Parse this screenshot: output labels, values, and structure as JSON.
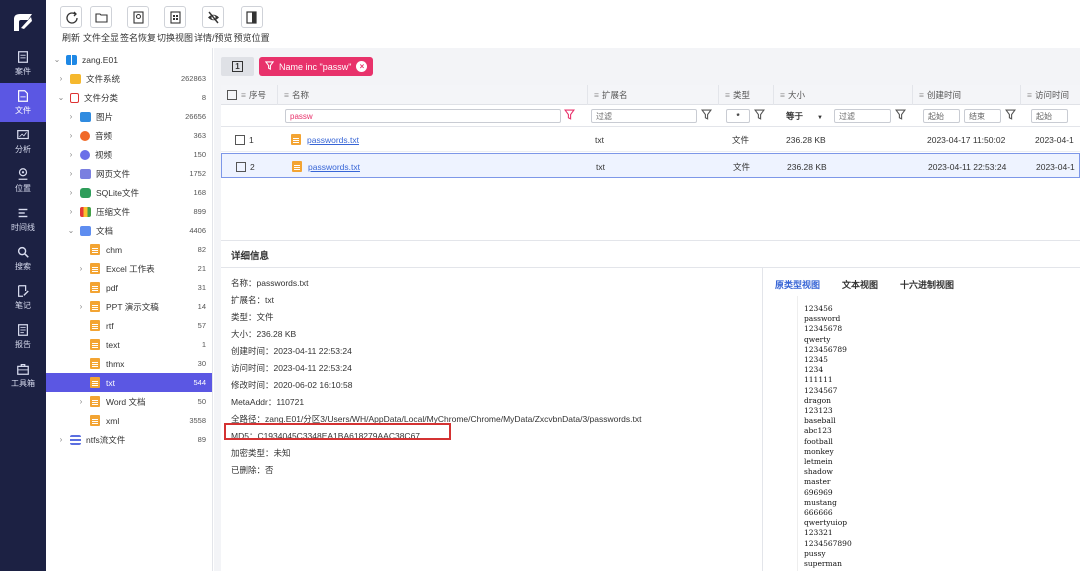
{
  "rail": [
    {
      "label": "案件",
      "icon": "case-icon"
    },
    {
      "label": "文件",
      "icon": "file-icon",
      "active": true
    },
    {
      "label": "分析",
      "icon": "analysis-icon"
    },
    {
      "label": "位置",
      "icon": "location-icon"
    },
    {
      "label": "时间线",
      "icon": "timeline-icon"
    },
    {
      "label": "搜索",
      "icon": "search-icon"
    },
    {
      "label": "笔记",
      "icon": "note-icon"
    },
    {
      "label": "报告",
      "icon": "report-icon"
    },
    {
      "label": "工具箱",
      "icon": "toolbox-icon"
    }
  ],
  "toolbar": [
    {
      "label": "刷新",
      "icon": "refresh-icon"
    },
    {
      "label": "文件全显",
      "icon": "folder-icon"
    },
    {
      "label": "签名恢复",
      "icon": "signature-icon"
    },
    {
      "label": "切换视图",
      "icon": "switch-view-icon"
    },
    {
      "label": "详情/预览",
      "icon": "eye-slash-icon"
    },
    {
      "label": "预览位置",
      "icon": "panel-position-icon"
    }
  ],
  "tree": [
    {
      "label": "zang.E01",
      "count": "",
      "indent": 0,
      "chev": "v",
      "icon": "windows"
    },
    {
      "label": "文件系统",
      "count": "262863",
      "indent": 1,
      "chev": ">",
      "icon": "folder"
    },
    {
      "label": "文件分类",
      "count": "8",
      "indent": 1,
      "chev": "v",
      "icon": "doc-outline"
    },
    {
      "label": "图片",
      "count": "26656",
      "indent": 2,
      "chev": ">",
      "icon": "image"
    },
    {
      "label": "音频",
      "count": "363",
      "indent": 2,
      "chev": ">",
      "icon": "audio"
    },
    {
      "label": "视频",
      "count": "150",
      "indent": 2,
      "chev": ">",
      "icon": "video"
    },
    {
      "label": "网页文件",
      "count": "1752",
      "indent": 2,
      "chev": ">",
      "icon": "web"
    },
    {
      "label": "SQLite文件",
      "count": "168",
      "indent": 2,
      "chev": ">",
      "icon": "sqlite"
    },
    {
      "label": "压缩文件",
      "count": "899",
      "indent": 2,
      "chev": ">",
      "icon": "zip"
    },
    {
      "label": "文档",
      "count": "4406",
      "indent": 2,
      "chev": "v",
      "icon": "docs"
    },
    {
      "label": "chm",
      "count": "82",
      "indent": 3,
      "chev": "",
      "icon": "file"
    },
    {
      "label": "Excel 工作表",
      "count": "21",
      "indent": 3,
      "chev": ">",
      "icon": "file"
    },
    {
      "label": "pdf",
      "count": "31",
      "indent": 3,
      "chev": "",
      "icon": "file"
    },
    {
      "label": "PPT 演示文稿",
      "count": "14",
      "indent": 3,
      "chev": ">",
      "icon": "file"
    },
    {
      "label": "rtf",
      "count": "57",
      "indent": 3,
      "chev": "",
      "icon": "file"
    },
    {
      "label": "text",
      "count": "1",
      "indent": 3,
      "chev": "",
      "icon": "file"
    },
    {
      "label": "thmx",
      "count": "30",
      "indent": 3,
      "chev": "",
      "icon": "file"
    },
    {
      "label": "txt",
      "count": "544",
      "indent": 3,
      "chev": "",
      "icon": "file",
      "selected": true
    },
    {
      "label": "Word 文档",
      "count": "50",
      "indent": 3,
      "chev": ">",
      "icon": "file"
    },
    {
      "label": "xml",
      "count": "3558",
      "indent": 3,
      "chev": "",
      "icon": "file"
    },
    {
      "label": "ntfs流文件",
      "count": "89",
      "indent": 1,
      "chev": ">",
      "icon": "stream"
    }
  ],
  "filter": {
    "tab_number": "1",
    "chip": "Name inc \"passw\""
  },
  "grid": {
    "headers": {
      "seq": "序号",
      "name": "名称",
      "ext": "扩展名",
      "type": "类型",
      "size": "大小",
      "ctime": "创建时间",
      "atime": "访问时间"
    },
    "filters": {
      "name": "passw",
      "ext": "过滤",
      "type": "*",
      "size_op": "等于",
      "size": "过滤",
      "c_start": "起始",
      "c_end": "结束",
      "a_start": "起始"
    },
    "rows": [
      {
        "seq": "1",
        "name": "passwords.txt",
        "ext": "txt",
        "type": "文件",
        "size": "236.28 KB",
        "ctime": "2023-04-17 11:50:02",
        "atime": "2023-04-1"
      },
      {
        "seq": "2",
        "name": "passwords.txt",
        "ext": "txt",
        "type": "文件",
        "size": "236.28 KB",
        "ctime": "2023-04-11 22:53:24",
        "atime": "2023-04-1",
        "selected": true
      }
    ]
  },
  "detail": {
    "title": "详细信息",
    "lines": [
      "名称：passwords.txt",
      "扩展名：txt",
      "类型：文件",
      "大小：236.28 KB",
      "创建时间：2023-04-11 22:53:24",
      "访问时间：2023-04-11 22:53:24",
      "修改时间：2020-06-02 16:10:58",
      "MetaAddr：110721",
      "全路径：zang.E01/分区3/Users/WH/AppData/Local/MyChrome/Chrome/MyData/ZxcvbnData/3/passwords.txt",
      "MD5：C1934045C3348EA1BA618279AAC38C67",
      "加密类型：未知",
      "已删除：否"
    ],
    "tabs": [
      "原类型视图",
      "文本视图",
      "十六进制视图"
    ],
    "text_lines": [
      "123456",
      "password",
      "12345678",
      "qwerty",
      "123456789",
      "12345",
      "1234",
      "111111",
      "1234567",
      "dragon",
      "123123",
      "baseball",
      "abc123",
      "football",
      "monkey",
      "letmein",
      "shadow",
      "master",
      "696969",
      "mustang",
      "666666",
      "qwertyuiop",
      "123321",
      "1234567890",
      "pussy",
      "superman"
    ]
  },
  "colors": {
    "rail": "#1c2143",
    "accent": "#5b57e3",
    "chip": "#e8326b",
    "md5_box": "#d43232",
    "link": "#3765d6"
  }
}
